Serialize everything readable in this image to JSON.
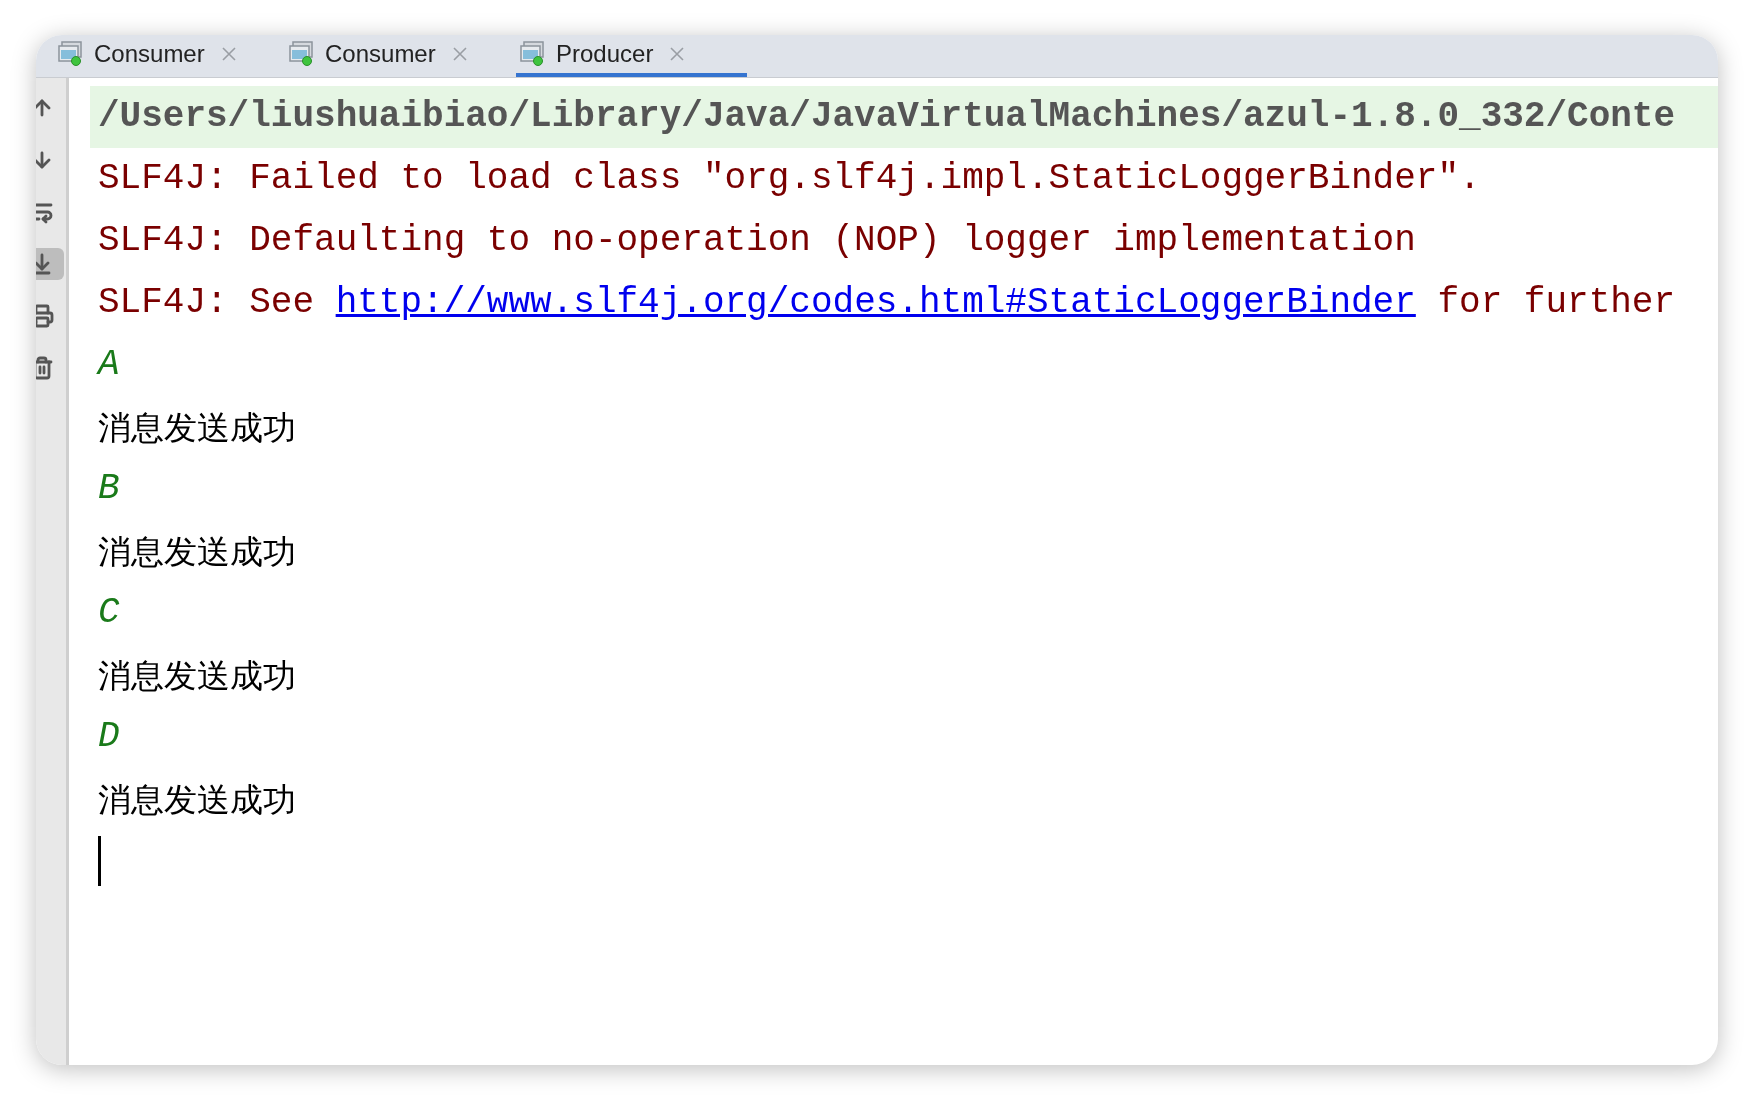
{
  "tabs": [
    {
      "label": "Consumer",
      "selected": false
    },
    {
      "label": "Consumer",
      "selected": false
    },
    {
      "label": "Producer",
      "selected": true
    }
  ],
  "toolbar": [
    {
      "kind": "up",
      "on": false
    },
    {
      "kind": "down",
      "on": false
    },
    {
      "kind": "wrap",
      "on": false
    },
    {
      "kind": "scroll-end",
      "on": true
    },
    {
      "kind": "print",
      "on": false
    },
    {
      "kind": "clear",
      "on": false
    }
  ],
  "console": {
    "lines": [
      {
        "kind": "command",
        "text": "/Users/liushuaibiao/Library/Java/JavaVirtualMachines/azul-1.8.0_332/Conte"
      },
      {
        "kind": "error",
        "text": "SLF4J: Failed to load class \"org.slf4j.impl.StaticLoggerBinder\"."
      },
      {
        "kind": "error",
        "text": "SLF4J: Defaulting to no-operation (NOP) logger implementation"
      },
      {
        "kind": "error-link",
        "before": "SLF4J: See ",
        "link": "http://www.slf4j.org/codes.html#StaticLoggerBinder",
        "after": "for further"
      },
      {
        "kind": "input",
        "text": "A"
      },
      {
        "kind": "output",
        "text": "消息发送成功"
      },
      {
        "kind": "input",
        "text": "B"
      },
      {
        "kind": "output",
        "text": "消息发送成功"
      },
      {
        "kind": "input",
        "text": "C"
      },
      {
        "kind": "output",
        "text": "消息发送成功"
      },
      {
        "kind": "input",
        "text": "D"
      },
      {
        "kind": "output",
        "text": "消息发送成功"
      }
    ],
    "cursor": true
  }
}
